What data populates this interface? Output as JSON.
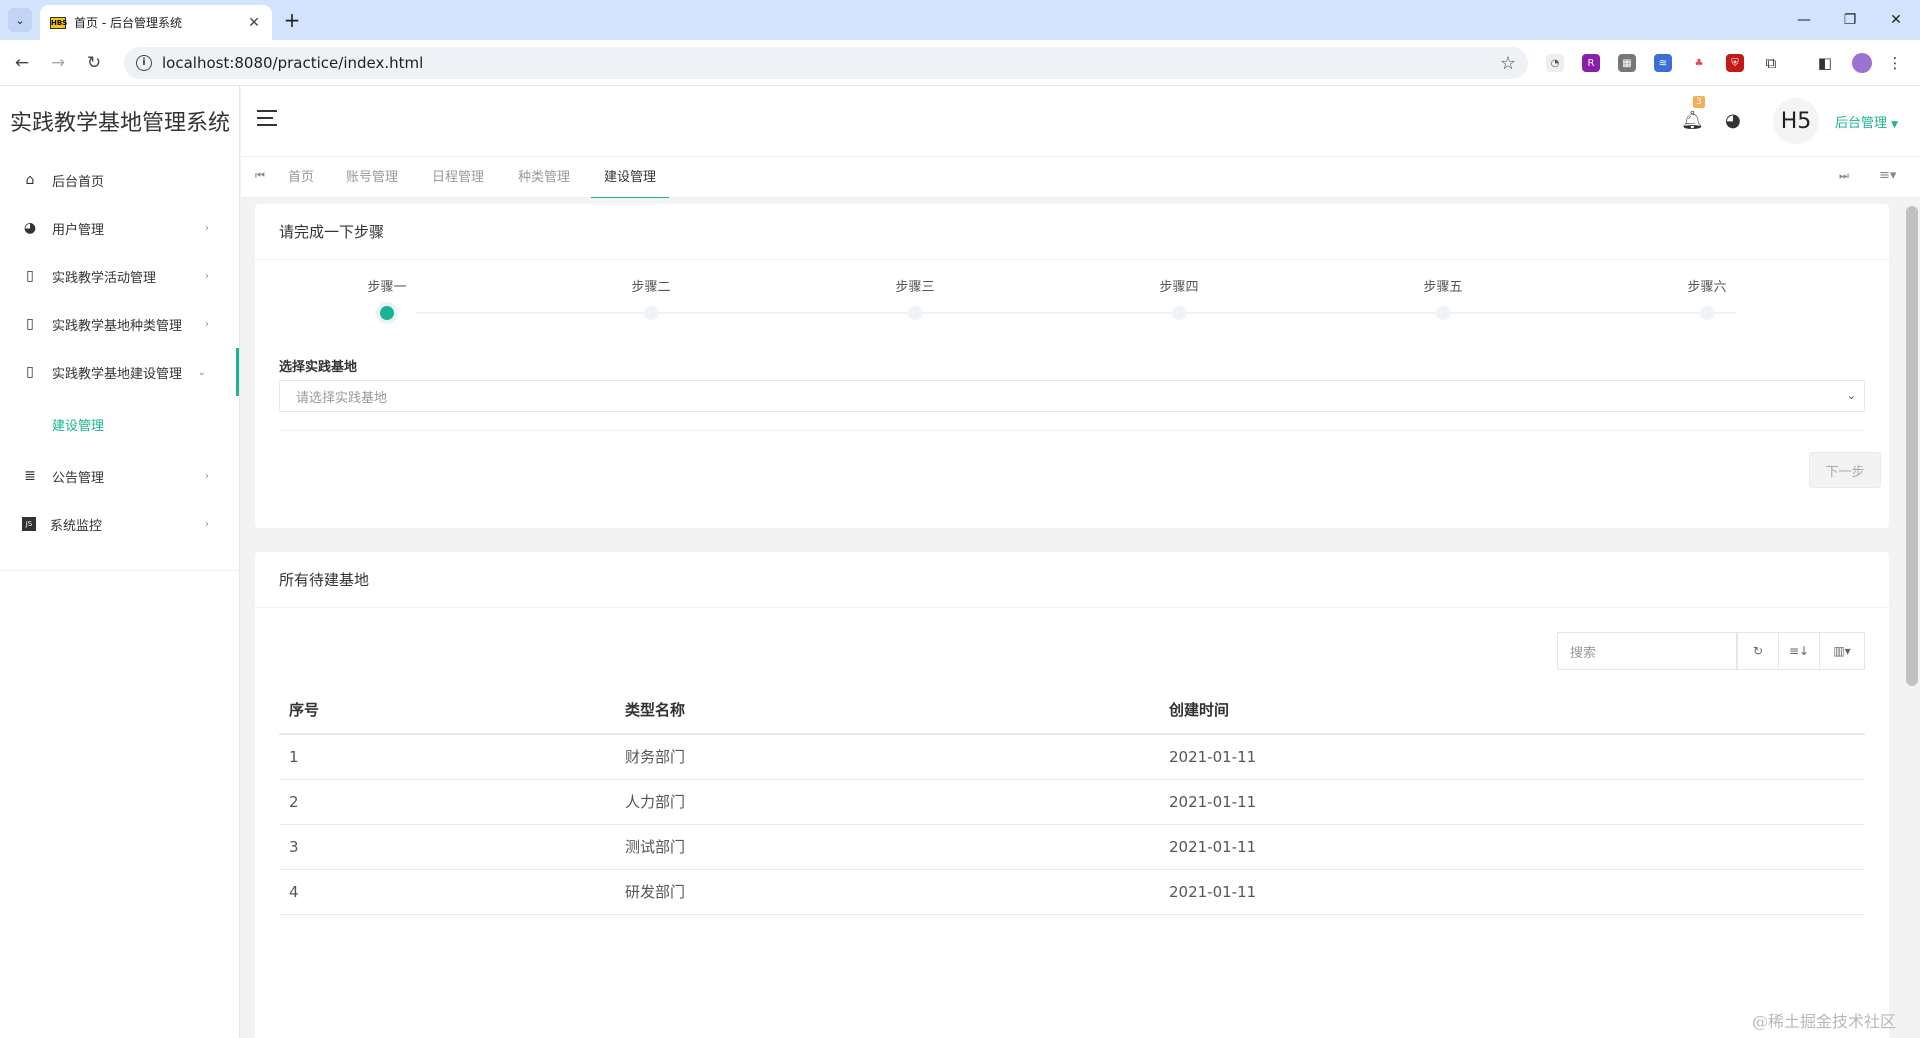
{
  "browser": {
    "tab_title": "首页 - 后台管理系统",
    "url": "localhost:8080/practice/index.html"
  },
  "app": {
    "title": "实践教学基地管理系统",
    "user_menu": "后台管理",
    "avatar_text": "H5",
    "notification_count": "3"
  },
  "sidebar": {
    "items": [
      {
        "label": "后台首页",
        "icon": "home-icon"
      },
      {
        "label": "用户管理",
        "icon": "palette-icon"
      },
      {
        "label": "实践教学活动管理",
        "icon": "file-icon"
      },
      {
        "label": "实践教学基地种类管理",
        "icon": "file-icon"
      },
      {
        "label": "实践教学基地建设管理",
        "icon": "file-icon"
      },
      {
        "label": "公告管理",
        "icon": "list-icon"
      },
      {
        "label": "系统监控",
        "icon": "js-icon"
      }
    ],
    "submenu_label": "建设管理"
  },
  "tabs": [
    "首页",
    "账号管理",
    "日程管理",
    "种类管理",
    "建设管理"
  ],
  "steps_panel": {
    "title": "请完成一下步骤",
    "steps": [
      "步骤一",
      "步骤二",
      "步骤三",
      "步骤四",
      "步骤五",
      "步骤六"
    ],
    "active_step": 1,
    "field_label": "选择实践基地",
    "select_placeholder": "请选择实践基地",
    "next_button": "下一步"
  },
  "list_panel": {
    "title": "所有待建基地",
    "search_placeholder": "搜索",
    "columns": [
      "序号",
      "类型名称",
      "创建时间"
    ],
    "rows": [
      [
        "1",
        "财务部门",
        "2021-01-11"
      ],
      [
        "2",
        "人力部门",
        "2021-01-11"
      ],
      [
        "3",
        "测试部门",
        "2021-01-11"
      ],
      [
        "4",
        "研发部门",
        "2021-01-11"
      ]
    ]
  },
  "watermark": "@稀土掘金技术社区",
  "colors": {
    "accent": "#1ab394",
    "badge": "#f8ac59"
  }
}
